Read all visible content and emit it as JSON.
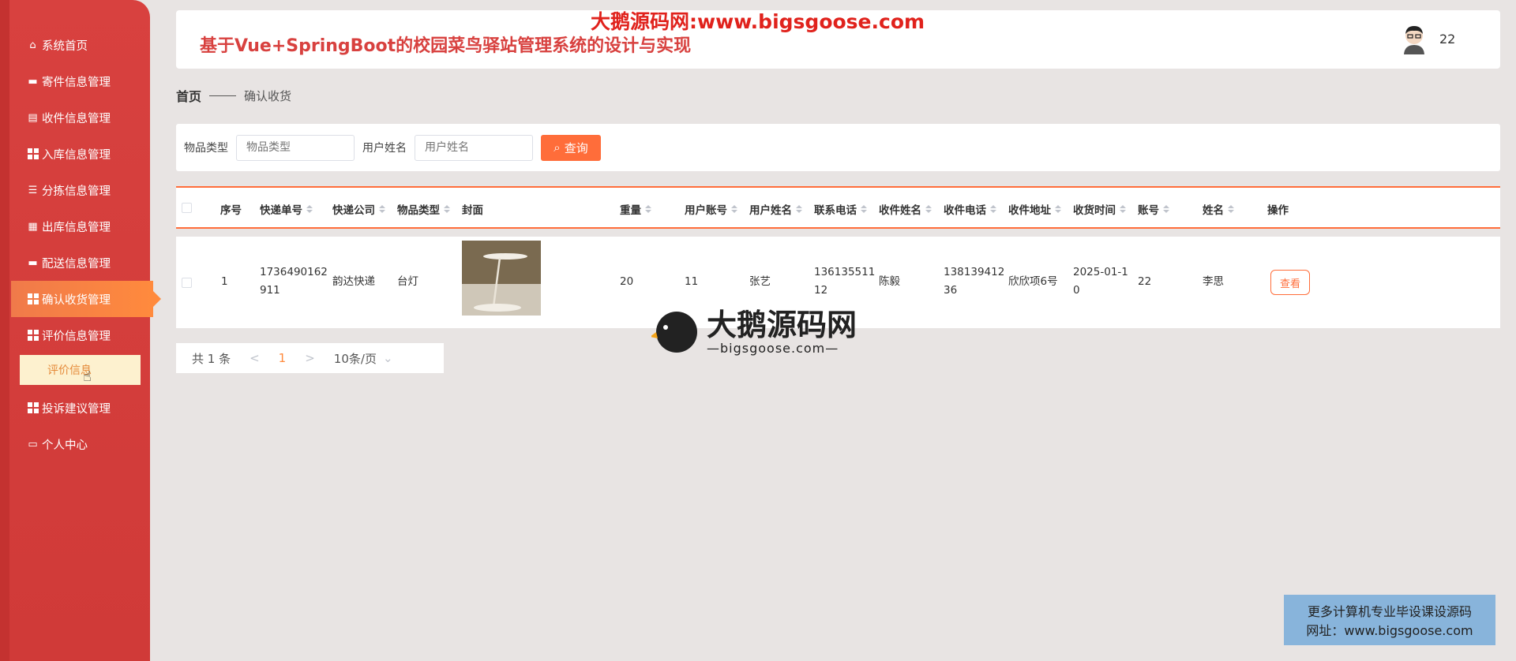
{
  "watermark": {
    "top": "大鹅源码网:www.bigsgoose.com",
    "logo_cn": "大鹅源码网",
    "logo_en": "—bigsgoose.com—",
    "banner_line1": "更多计算机专业毕设课设源码",
    "banner_line2": "网址：www.bigsgoose.com"
  },
  "header": {
    "title": "基于Vue+SpringBoot的校园菜鸟驿站管理系统的设计与实现",
    "user": "22"
  },
  "sidebar": {
    "items": [
      {
        "label": "系统首页",
        "icon": "home-icon"
      },
      {
        "label": "寄件信息管理",
        "icon": "monitor-icon"
      },
      {
        "label": "收件信息管理",
        "icon": "clipboard-icon"
      },
      {
        "label": "入库信息管理",
        "icon": "grid-icon"
      },
      {
        "label": "分拣信息管理",
        "icon": "list-icon"
      },
      {
        "label": "出库信息管理",
        "icon": "table-icon"
      },
      {
        "label": "配送信息管理",
        "icon": "chat-icon"
      },
      {
        "label": "确认收货管理",
        "icon": "grid-icon"
      },
      {
        "label": "评价信息管理",
        "icon": "grid-icon"
      },
      {
        "label": "投诉建议管理",
        "icon": "grid-icon"
      },
      {
        "label": "个人中心",
        "icon": "card-icon"
      }
    ],
    "sub_item": "评价信息"
  },
  "breadcrumb": {
    "home": "首页",
    "current": "确认收货"
  },
  "search": {
    "type_label": "物品类型",
    "type_placeholder": "物品类型",
    "name_label": "用户姓名",
    "name_placeholder": "用户姓名",
    "button": "查询"
  },
  "table": {
    "headers": [
      "序号",
      "快递单号",
      "快递公司",
      "物品类型",
      "封面",
      "重量",
      "用户账号",
      "用户姓名",
      "联系电话",
      "收件姓名",
      "收件电话",
      "收件地址",
      "收货时间",
      "账号",
      "姓名",
      "操作"
    ],
    "row": {
      "index": "1",
      "tracking_1": "1736490162",
      "tracking_2": "911",
      "company": "韵达快递",
      "type": "台灯",
      "weight": "20",
      "account": "11",
      "user_name": "张艺",
      "phone_1": "136135511",
      "phone_2": "12",
      "recv_name": "陈毅",
      "recv_phone_1": "138139412",
      "recv_phone_2": "36",
      "address": "欣欣项6号",
      "time_1": "2025-01-1",
      "time_2": "0",
      "acct": "22",
      "name": "李思",
      "action": "查看"
    }
  },
  "pagination": {
    "total": "共 1 条",
    "prev": "<",
    "current": "1",
    "next": ">",
    "size": "10条/页"
  }
}
